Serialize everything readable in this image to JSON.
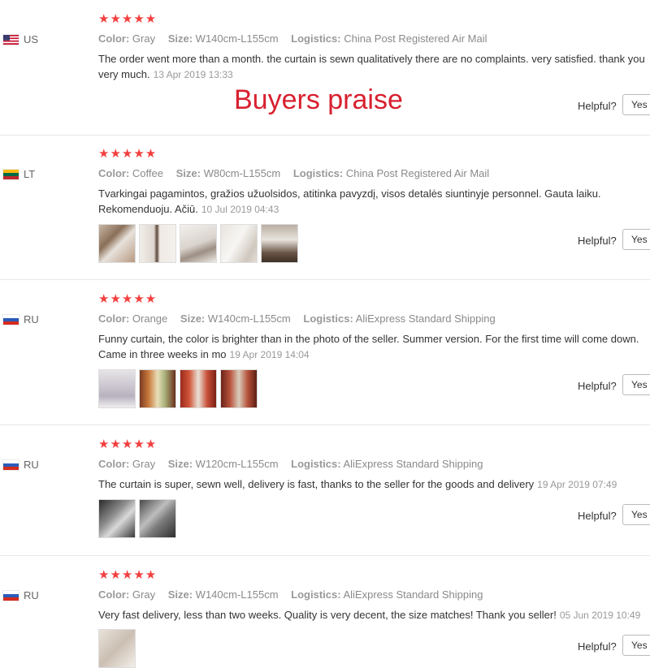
{
  "banner": "Buyers praise",
  "labels": {
    "color": "Color:",
    "size": "Size:",
    "logistics": "Logistics:",
    "helpful": "Helpful?",
    "yes": "Yes"
  },
  "stars": "★★★★★",
  "reviews": [
    {
      "country": "US",
      "color": "Gray",
      "size": "W140cm-L155cm",
      "logistics": "China Post Registered Air Mail",
      "text": "The order went more than a month. the curtain is sewn qualitatively there are no complaints. very satisfied. thank you very much.",
      "date": "13 Apr 2019 13:33",
      "photo_count": 0
    },
    {
      "country": "LT",
      "color": "Coffee",
      "size": "W80cm-L155cm",
      "logistics": "China Post Registered Air Mail",
      "text": "Tvarkingai pagamintos, gražios užuolsidos, atitinka pavyzdį, visos detalės siuntinyje personnel. Gauta laiku. Rekomenduoju. Ačiū.",
      "date": "10 Jul 2019 04:43",
      "photo_count": 5
    },
    {
      "country": "RU",
      "color": "Orange",
      "size": "W140cm-L155cm",
      "logistics": "AliExpress Standard Shipping",
      "text": "Funny curtain, the color is brighter than in the photo of the seller. Summer version. For the first time will come down. Came in three weeks in mo",
      "date": "19 Apr 2019 14:04",
      "photo_count": 4
    },
    {
      "country": "RU",
      "color": "Gray",
      "size": "W120cm-L155cm",
      "logistics": "AliExpress Standard Shipping",
      "text": "The curtain is super, sewn well, delivery is fast, thanks to the seller for the goods and delivery",
      "date": "19 Apr 2019 07:49",
      "photo_count": 2
    },
    {
      "country": "RU",
      "color": "Gray",
      "size": "W140cm-L155cm",
      "logistics": "AliExpress Standard Shipping",
      "text": "Very fast delivery, less than two weeks. Quality is very decent, the size matches! Thank you seller!",
      "date": "05 Jun 2019 10:49",
      "photo_count": 1
    }
  ]
}
